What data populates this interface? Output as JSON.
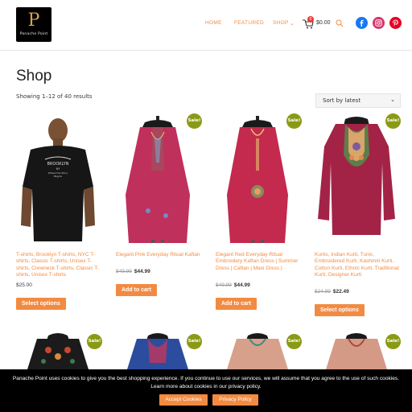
{
  "header": {
    "logo_mark": "P",
    "logo_text": "Panache Point",
    "nav": [
      "HOME",
      "FEATURED",
      "SHOP"
    ],
    "cart_count": "0",
    "cart_total": "$0.00",
    "social": [
      "facebook-icon",
      "instagram-icon",
      "pinterest-icon"
    ],
    "accent_color": "#f28b42"
  },
  "page": {
    "title": "Shop",
    "result_count": "Showing 1–12 of 40 results",
    "sort_value": "Sort by latest"
  },
  "products": [
    {
      "title": "T-shirts, Brooklyn T-shirts, NYC T-shirts, Classic T-shirts, Unisex T-shirts, Crewneck T-shirts, Classic T-shirts, Unisex T-shirts",
      "price": "$25.00",
      "old_price": "",
      "new_price": "",
      "sale": "",
      "button": "Select options",
      "shirt_text": "BROOKLYN NY Where the Story Begins"
    },
    {
      "title": "Elegant Pink Everyday Ritual Kaftan",
      "price": "",
      "old_price": "$49.99",
      "new_price": "$44.99",
      "sale": "Sale!",
      "button": "Add to cart"
    },
    {
      "title": "Elegant Red Everyday Ritual Embroidery Kaftan Dress | Summer Dress | Caftan | Maxi Dress |",
      "price": "",
      "old_price": "$49.99",
      "new_price": "$44.99",
      "sale": "Sale!",
      "button": "Add to cart"
    },
    {
      "title": "Kurtis, Indian Kurti, Tunic, Embroidered Kurti, Kashmiri Kurti, Cotton Kurti, Ethnic Kurti, Traditional Kurti, Designer Kurti",
      "price": "",
      "old_price": "$24.99",
      "new_price": "$22.49",
      "sale": "Sale!",
      "button": "Select options"
    }
  ],
  "products_row2": [
    {
      "sale": "Sale!"
    },
    {
      "sale": "Sale!"
    },
    {
      "sale": "Sale!"
    },
    {
      "sale": "Sale!"
    }
  ],
  "cookie": {
    "text": "Panache Point uses cookies to give you the best shopping experience. If you continue to use our services, we will assume that you agree to the use of such cookies. Learn more about cookies in our privacy policy.",
    "accept": "Accept Cookies",
    "privacy": "Privacy Policy"
  }
}
